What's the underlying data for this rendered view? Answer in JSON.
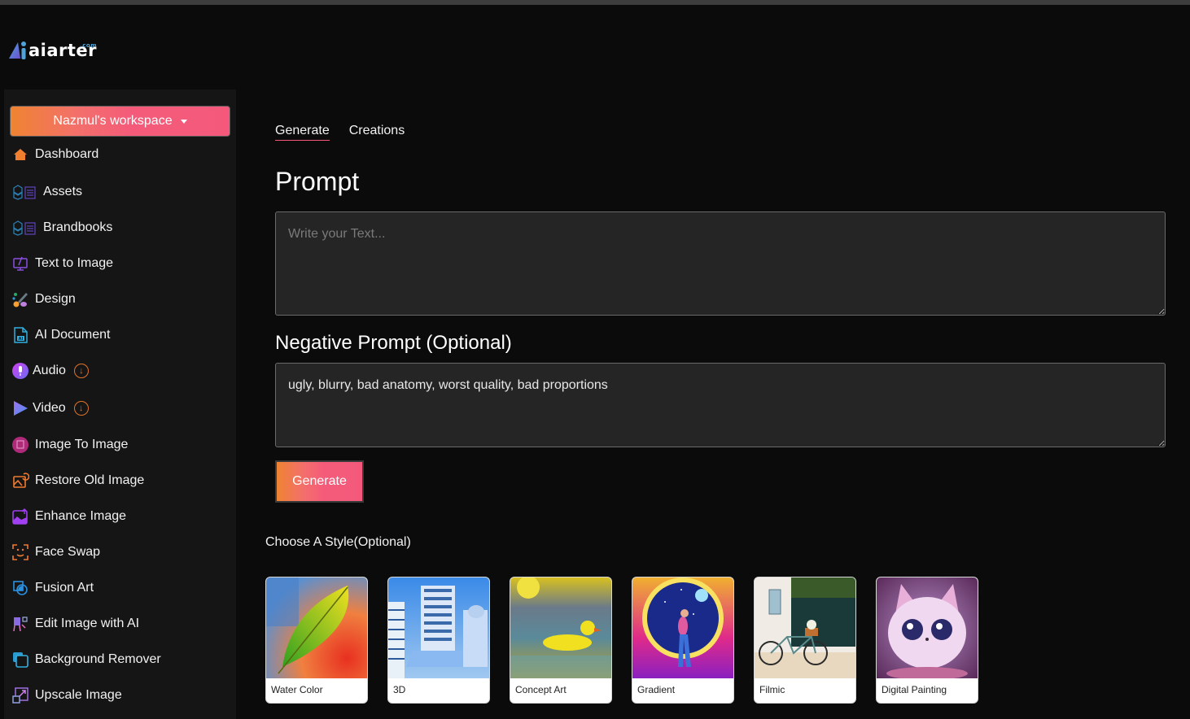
{
  "brand": {
    "name": "aiarter",
    "suffix": ".com"
  },
  "sidebar": {
    "workspace_label": "Nazmul's workspace",
    "items": [
      {
        "label": "Dashboard",
        "icon": "home-icon"
      },
      {
        "label": "Assets",
        "icon": "assets-icon"
      },
      {
        "label": "Brandbooks",
        "icon": "brandbooks-icon"
      },
      {
        "label": "Text to Image",
        "icon": "text-to-image-icon"
      },
      {
        "label": "Design",
        "icon": "paintbrush-icon"
      },
      {
        "label": "AI Document",
        "icon": "ai-document-icon"
      },
      {
        "label": "Audio",
        "icon": "microphone-icon",
        "badge": "download-icon"
      },
      {
        "label": "Video",
        "icon": "play-icon",
        "badge": "download-icon"
      },
      {
        "label": "Image To Image",
        "icon": "image-to-image-icon"
      },
      {
        "label": "Restore Old Image",
        "icon": "restore-image-icon"
      },
      {
        "label": "Enhance Image",
        "icon": "enhance-image-icon"
      },
      {
        "label": "Face Swap",
        "icon": "face-scan-icon"
      },
      {
        "label": "Fusion Art",
        "icon": "fusion-icon"
      },
      {
        "label": "Edit Image with AI",
        "icon": "easel-icon"
      },
      {
        "label": "Background Remover",
        "icon": "background-remover-icon"
      },
      {
        "label": "Upscale Image",
        "icon": "upscale-icon"
      }
    ]
  },
  "main": {
    "tabs": [
      {
        "label": "Generate",
        "active": true
      },
      {
        "label": "Creations",
        "active": false
      }
    ],
    "prompt_heading": "Prompt",
    "prompt_placeholder": "Write your Text...",
    "prompt_value": "",
    "negative_heading": "Negative Prompt (Optional)",
    "negative_value": "ugly, blurry, bad anatomy, worst quality, bad proportions",
    "generate_label": "Generate",
    "style_heading": "Choose A Style(Optional)",
    "styles": [
      {
        "label": "Water Color"
      },
      {
        "label": "3D"
      },
      {
        "label": "Concept Art"
      },
      {
        "label": "Gradient"
      },
      {
        "label": "Filmic"
      },
      {
        "label": "Digital Painting"
      }
    ]
  },
  "colors": {
    "accent_orange": "#ef8431",
    "accent_pink": "#f4597b",
    "background": "#0b0b0b",
    "sidebar": "#151515",
    "input_bg": "#252525"
  }
}
